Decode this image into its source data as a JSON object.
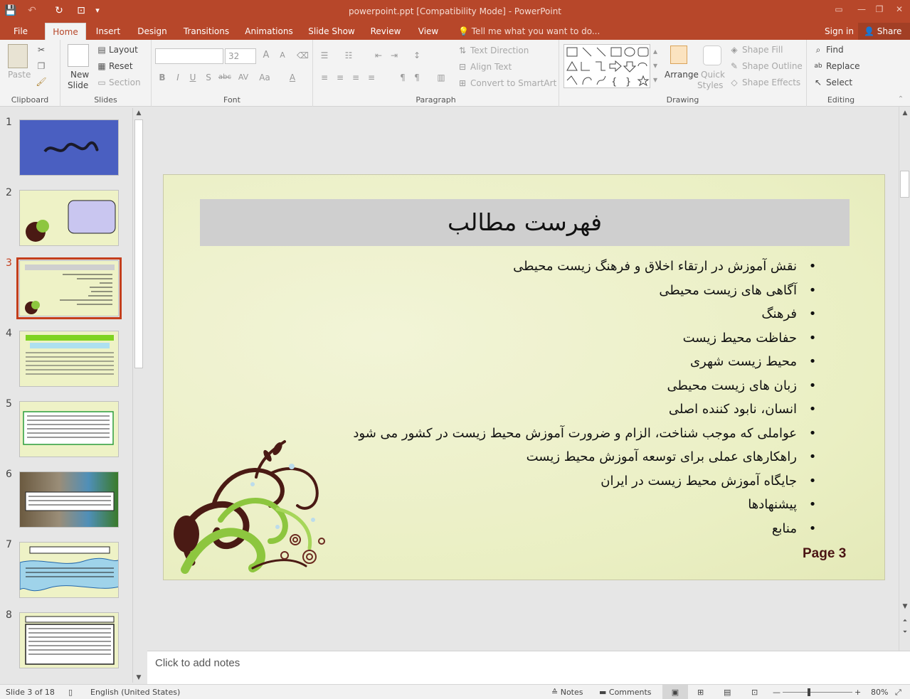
{
  "window": {
    "title": "powerpoint.ppt [Compatibility Mode] - PowerPoint",
    "controls": {
      "ribbon_options": "▭",
      "minimize": "—",
      "restore": "❐",
      "close": "✕"
    }
  },
  "quick_access": {
    "save": "💾",
    "undo": "↶",
    "redo": "↻",
    "present": "⊡",
    "customize": "▾"
  },
  "tabs": [
    {
      "label": "File"
    },
    {
      "label": "Home"
    },
    {
      "label": "Insert"
    },
    {
      "label": "Design"
    },
    {
      "label": "Transitions"
    },
    {
      "label": "Animations"
    },
    {
      "label": "Slide Show"
    },
    {
      "label": "Review"
    },
    {
      "label": "View"
    }
  ],
  "tell_me": "Tell me what you want to do...",
  "sign_in": "Sign in",
  "share": "Share",
  "ribbon": {
    "clipboard": {
      "label": "Clipboard",
      "paste": "Paste"
    },
    "slides": {
      "label": "Slides",
      "new_slide_1": "New",
      "new_slide_2": "Slide",
      "layout": "Layout",
      "reset": "Reset",
      "section": "Section"
    },
    "font": {
      "label": "Font",
      "font_size": "32",
      "bold": "B",
      "italic": "I",
      "underline": "U",
      "shadow": "S",
      "strike": "abc",
      "spacing": "AV",
      "case": "Aa",
      "color": "A",
      "grow": "A",
      "shrink": "A"
    },
    "paragraph": {
      "label": "Paragraph",
      "text_direction": "Text Direction",
      "align_text": "Align Text",
      "smartart": "Convert to SmartArt"
    },
    "drawing": {
      "label": "Drawing",
      "arrange": "Arrange",
      "quick_styles_1": "Quick",
      "quick_styles_2": "Styles",
      "shape_fill": "Shape Fill",
      "shape_outline": "Shape Outline",
      "shape_effects": "Shape Effects"
    },
    "editing": {
      "label": "Editing",
      "find": "Find",
      "replace": "Replace",
      "select": "Select"
    }
  },
  "thumbnails": [
    {
      "num": "1"
    },
    {
      "num": "2"
    },
    {
      "num": "3"
    },
    {
      "num": "4"
    },
    {
      "num": "5"
    },
    {
      "num": "6"
    },
    {
      "num": "7"
    },
    {
      "num": "8"
    }
  ],
  "slide": {
    "title": "فهرست مطالب",
    "bullets": [
      "نقش آموزش در ارتقاء اخلاق و فرهنگ زیست محیطی",
      "آگاهی های زیست محیطی",
      "فرهنگ",
      "حفاظت محیط زیست",
      "محیط زیست شهری",
      "زبان های زیست محیطی",
      "انسان، نابود کننده اصلی",
      "عواملی که موجب شناخت، الزام و ضرورت آموزش محیط زیست در کشور می شود",
      "راهکارهای عملی برای توسعه آموزش محیط زیست",
      "جایگاه آموزش محیط زیست در ایران",
      "پیشنهادها",
      "منابع"
    ],
    "bullet_char": "•",
    "page_label": "Page 3",
    "colors": {
      "background": "#eaefc3",
      "title_band": "#cfcfcf",
      "flourish_brown": "#4a1a14",
      "flourish_green": "#8dc63f"
    }
  },
  "notes": {
    "placeholder": "Click to add notes"
  },
  "status": {
    "slide_counter": "Slide 3 of 18",
    "language": "English (United States)",
    "notes": "Notes",
    "comments": "Comments",
    "zoom": "80%"
  },
  "accent_color": "#b7472a"
}
